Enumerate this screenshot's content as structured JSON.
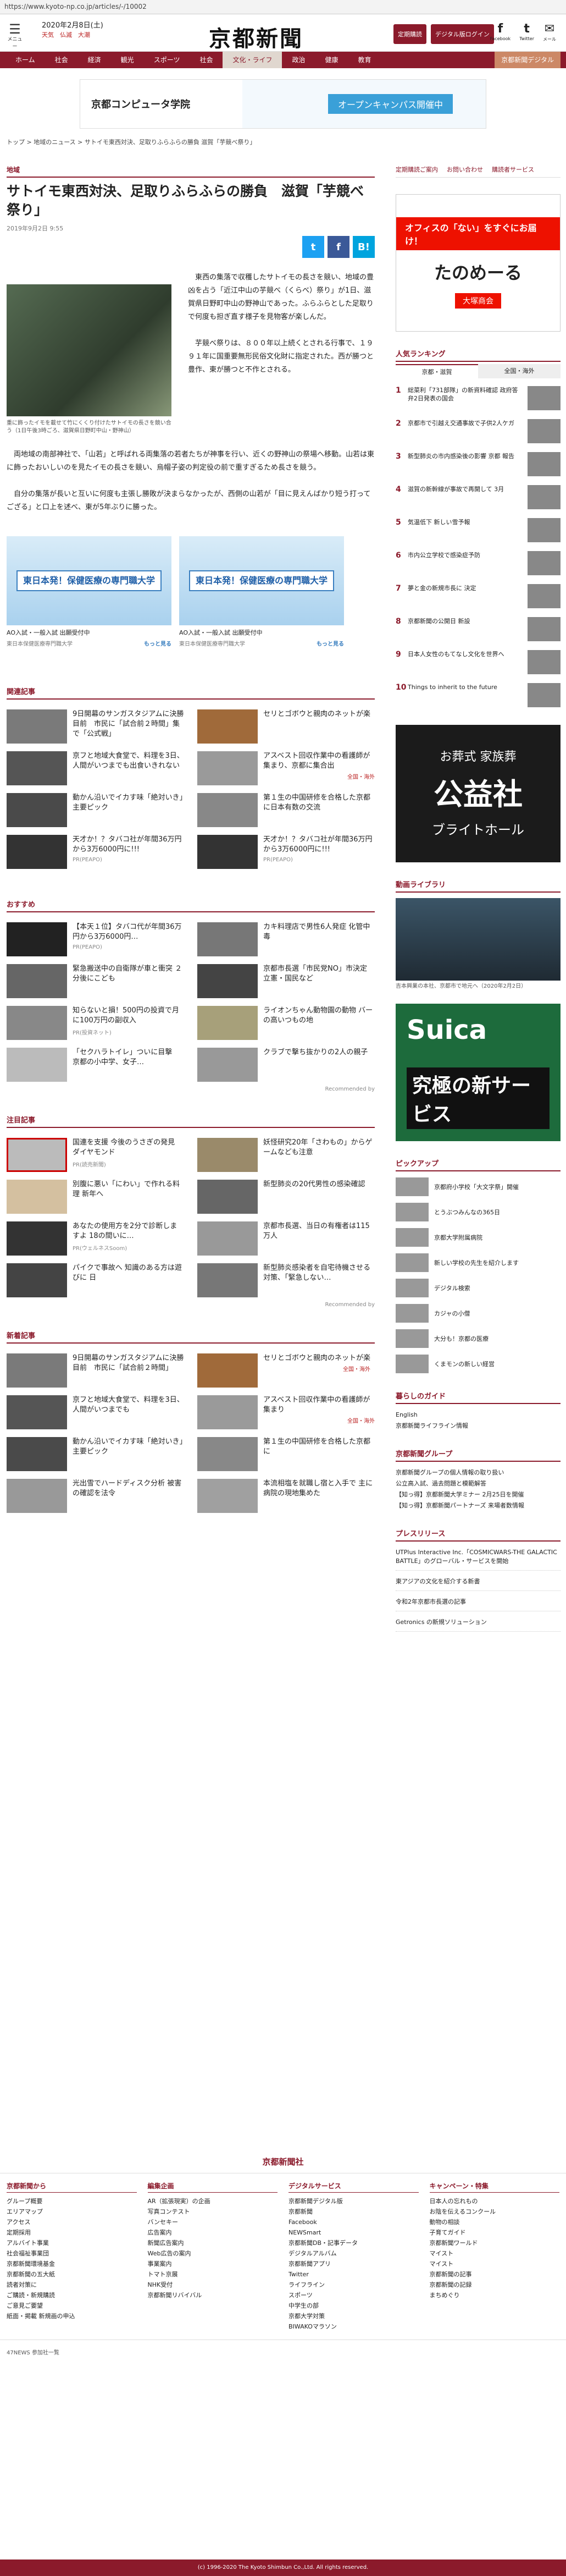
{
  "url": "https://www.kyoto-np.co.jp/articles/-/10002",
  "header": {
    "menu": "メニュー",
    "date": "2020年2月8日(土)",
    "weather": "天気",
    "fortune": "仏滅",
    "tide": "大潮",
    "logo": "京都新聞",
    "btn1": "定期購読",
    "btn2": "デジタル版ログイン",
    "social": [
      {
        "icon": "f",
        "label": "Facebook"
      },
      {
        "icon": "t",
        "label": "Twitter"
      },
      {
        "icon": "✉",
        "label": "メール"
      }
    ]
  },
  "nav": [
    "ホーム",
    "社会",
    "経済",
    "観光",
    "スポーツ",
    "社会",
    "文化・ライフ",
    "政治",
    "健康",
    "教育",
    "京都新聞デジタル"
  ],
  "nav_active": 6,
  "banner": {
    "left": "京都コンピュータ学院",
    "right": "オープンキャンパス開催中"
  },
  "breadcrumb": "トップ > 地域のニュース > サトイモ東西対決、足取りふらふらの勝負 滋賀「芋競べ祭り」",
  "article": {
    "category": "地域",
    "title": "サトイモ東西対決、足取りふらふらの勝負　滋賀「芋競べ祭り」",
    "date": "2019年9月2日 9:55",
    "share": [
      "t",
      "f",
      "B!"
    ],
    "caption": "重に飾ったイモを載せて竹にくくり付けたサトイモの長さを競い合う（1日午後3時ごろ、滋賀県日野町中山・野神山）",
    "p1": "東西の集落で収穫したサトイモの長さを競い、地域の豊凶を占う「近江中山の芋競べ（くらべ）祭り」が1日、滋賀県日野町中山の野神山であった。ふらふらとした足取りで何度も担ぎ直す様子を見物客が楽しんだ。",
    "p2": "芋競べ祭りは、８００年以上続くとされる行事で、１９９１年に国重要無形民俗文化財に指定された。西が勝つと豊作、東が勝つと不作とされる。",
    "p3": "両地域の南部神社で、「山若」と呼ばれる両集落の若者たちが神事を行い、近くの野神山の祭場へ移動。山若は東に飾ったおいしいのを見たイモの長さを競い、烏帽子姿の判定役の前で重すぎるため長さを競う。",
    "p4": "自分の集落が長いと互いに何度も主張し勝敗が決まらなかったが、西側の山若が「目に見えんばかり短う打ってござる」と口上を述べ、東が5年ぶりに勝った。"
  },
  "promos": [
    {
      "img": "東日本発！保健医療の専門職大学",
      "text": "AO入試・一般入試 出願受付中",
      "sub": "東日本保健医療専門職大学",
      "more": "もっと見る"
    },
    {
      "img": "東日本発！保健医療の専門職大学",
      "text": "AO入試・一般入試 出願受付中",
      "sub": "東日本保健医療専門職大学",
      "more": "もっと見る"
    }
  ],
  "related": {
    "heading": "関連記事",
    "items": [
      {
        "t": "9日開幕のサンガスタジアムに決勝目前　市民に「試合前２時間」集で「公式戦」",
        "tag": "",
        "bg": "#7a7a7a"
      },
      {
        "t": "セリとゴボウと親肉のネットが楽",
        "tag": "",
        "bg": "#a06a3a"
      },
      {
        "t": "京フと地域大食堂で、料理を3日、人間がいつまでも出食いきれない",
        "tag": "",
        "bg": "#555"
      },
      {
        "t": "アスベスト回収作業中の看護師が集まり、京都に集合出",
        "tag": "全国・海外",
        "bg": "#9a9a9a"
      },
      {
        "t": "動かん沿いでイカす味「絶対いき」主要ピック",
        "tag": "",
        "bg": "#4a4a4a"
      },
      {
        "t": "第１生の中国研修を合格した京都に日本有数の交流",
        "tag": "",
        "bg": "#888"
      },
      {
        "t": "天才か！？タバコ社が年間36万円から3万6000円に!!!",
        "tag": "PR(PEAPO)",
        "bg": "#333"
      },
      {
        "t": "天才か！？タバコ社が年間36万円から3万6000円に!!!",
        "tag": "PR(PEAPO)",
        "bg": "#333"
      }
    ]
  },
  "recommend": {
    "heading": "おすすめ",
    "by": "Recommended by",
    "items": [
      {
        "t": "【本天１位】タバコ代が年間36万円から3万6000円…",
        "tag": "PR(PEAPO)",
        "bg": "#222"
      },
      {
        "t": "カキ料理店で男性6人発症 化管中毒",
        "tag": "",
        "bg": "#777"
      },
      {
        "t": "緊急搬送中の自衛隊が車と衝突 ２分後にこども",
        "tag": "",
        "bg": "#666"
      },
      {
        "t": "京都市長選「市民党NO」市決定 立憲・国民など",
        "tag": "",
        "bg": "#444"
      },
      {
        "t": "知らないと損！500円の投資で月に100万円の副収入",
        "tag": "PR(投資ネット)",
        "bg": "#888"
      },
      {
        "t": "ライオンちゃん動物園の動物 バーの高いつもの地",
        "tag": "",
        "bg": "#a7a07a"
      },
      {
        "t": "「セクハラトイレ」ついに目撃　京都の小中学、女子…",
        "tag": "",
        "bg": "#bbb"
      },
      {
        "t": "クラブで撃ち抜かりの2人の親子 ",
        "tag": "",
        "bg": "#999"
      }
    ]
  },
  "attention": {
    "heading": "注目記事",
    "by": "Recommended by",
    "items": [
      {
        "t": "国連を支援 今後のうさぎの発見 ダイヤモンド",
        "tag": "PR(読売新聞)",
        "bg": "#bbb",
        "featured": true
      },
      {
        "t": "妖怪研究20年「さわもの」からゲームなども注意",
        "tag": "",
        "bg": "#9a8a6a"
      },
      {
        "t": "別腹に悪い「にわい」で作れる料理 新年へ",
        "tag": "",
        "bg": "#d4c0a0"
      },
      {
        "t": "新型肺炎の20代男性の感染確認",
        "tag": "",
        "bg": "#666"
      },
      {
        "t": "あなたの使用方を2分で診断しますよ 18の間いに…",
        "tag": "PR(ウェルネスSoom)",
        "bg": "#333"
      },
      {
        "t": "京都市長選、当日の有権者は115万人",
        "tag": "",
        "bg": "#999"
      },
      {
        "t": "パイクで事故へ 知識のある方は遊びに 日",
        "tag": "",
        "bg": "#444"
      },
      {
        "t": "新型肺炎感染者を自宅待機させる対策、「緊急しない…",
        "tag": "",
        "bg": "#777"
      }
    ]
  },
  "latest": {
    "heading": "新着記事",
    "items": [
      {
        "t": "9日開幕のサンガスタジアムに決勝目前　市民に「試合前２時間」",
        "tag": "",
        "bg": "#7a7a7a"
      },
      {
        "t": "セリとゴボウと親肉のネットが楽",
        "tag": "全国・海外",
        "bg": "#a06a3a"
      },
      {
        "t": "京フと地域大食堂で、料理を3日、人間がいつまでも",
        "tag": "",
        "bg": "#555"
      },
      {
        "t": "アスベスト回収作業中の看護師が集まり",
        "tag": "全国・海外",
        "bg": "#9a9a9a"
      },
      {
        "t": "動かん沿いでイカす味「絶対いき」主要ピック",
        "tag": "",
        "bg": "#4a4a4a"
      },
      {
        "t": "第１生の中国研修を合格した京都に",
        "tag": "",
        "bg": "#888"
      },
      {
        "t": "光出雪でハードディスク分析 被害の確認を法令",
        "tag": "",
        "bg": "#999"
      },
      {
        "t": "本流相塩を就職し宿と入手で 主に病院の現地集めた",
        "tag": "",
        "bg": "#a0a0a0"
      }
    ]
  },
  "side": {
    "links": [
      "定期購読ご案内",
      "お問い合わせ",
      "購読者サービス"
    ],
    "ad1": {
      "top": "オフィスの「ない」をすぐにお届け！",
      "mid": "たのめーる",
      "bot": "大塚商会"
    },
    "ranking": {
      "heading": "人気ランキング",
      "tabs": [
        "京都・滋賀",
        "全国・海外"
      ],
      "items": [
        "総菜利「731部隊」の新資料確認 政府答弁2日発表の国会",
        "京都市で引越え交通事故で子供2人ケガ",
        "新型肺炎の市内感染後の影響 京都 報告",
        "滋賀の新幹線が事故で再開して 3月",
        "気温低下 新しい雪予報",
        "市内公立学校で感染症予防",
        "夢と金の新規市長に 決定",
        "京都新聞の公開日 新設",
        "日本人女性のもてなし文化を世界へ",
        "Things to inherit to the future"
      ]
    },
    "ad2": {
      "a": "お葬式 家族葬",
      "b": "公益社",
      "c": "ブライトホール"
    },
    "video": {
      "heading": "動画ライブラリ",
      "cap": "吉本興業の本社、京都市で地元へ（2020年2月2日）"
    },
    "ad3": {
      "a": "Suica",
      "b": "究極の新サービス"
    },
    "pickup": {
      "heading": "ピックアップ",
      "items": [
        "京都府小学校「大文字祭」開催",
        "とうぶつみんなの365日",
        "京都大学附属病院",
        "新しい学校の先生を紹介します",
        "デジタル検索",
        "カジャの小僧",
        "大分も！京都の医療",
        "くまモンの新しい経営"
      ]
    },
    "guide": {
      "heading": "暮らしのガイド",
      "items": [
        "English",
        "京都新聞ライフライン情報"
      ]
    },
    "group": {
      "heading": "京都新聞グループ",
      "items": [
        "京都新聞グループの個人情報の取り扱い",
        "公立高入試、過去問題と模範解答",
        "【知っ得】京都新聞大学ミナー 2月25日を開催",
        "【知っ得】京都新聞パートナーズ 来場者数情報"
      ]
    },
    "press": {
      "heading": "プレスリリース",
      "items": [
        "UTPlus Interactive Inc.「COSMICWARS-THE GALACTIC BATTLE」のグローバル・サービスを開始",
        "東アジアの文化を紹介する新書",
        "令和2年京都市長選の記事",
        "Getronics の新規ソリューション"
      ]
    }
  },
  "footer": {
    "logo": "京都新聞社",
    "cols": [
      {
        "h": "京都新聞から",
        "items": [
          "グループ概要",
          "エリアマップ",
          "アクセス",
          "定期採用",
          "アルバイト事業",
          "社会福祉事業団",
          "京都新聞環境基金",
          "京都新聞の五大紙",
          "読者対策に",
          "ご購読・新規購読",
          "ご意見ご要望",
          "紙面・掲載 新規画の申込"
        ]
      },
      {
        "h": "編集企画",
        "items": [
          "AR（拡張現実）の企画",
          "写真コンテスト",
          "バンセキー",
          "広告案内",
          "新聞広告案内",
          "Web広告の案内",
          "事業案内",
          "トマト京展",
          "NHK受付",
          "京都新聞リバイバル"
        ]
      },
      {
        "h": "デジタルサービス",
        "items": [
          "京都新聞デジタル版",
          "京都新聞",
          "Facebook",
          "NEWSmart",
          "京都新聞DB・記事データ",
          "デジタルアルバム",
          "京都新聞アプリ",
          "Twitter",
          "ライフライン",
          "スポーツ",
          "中学生の部",
          "京都大学対策",
          "BIWAKOマラソン"
        ]
      },
      {
        "h": "キャンペーン・特集",
        "items": [
          "日本人の忘れもの",
          "お陰を伝えるコンクール",
          "動物の相談",
          "子育てガイド",
          "京都新聞ワールド",
          "マイスト",
          "マイスト",
          "京都新聞の記事",
          "京都新聞の記録",
          "まちめぐり"
        ]
      }
    ],
    "network": "47NEWS 参加社一覧",
    "copy": "(c) 1996-2020 The Kyoto Shimbun Co.,Ltd. All rights reserved."
  }
}
